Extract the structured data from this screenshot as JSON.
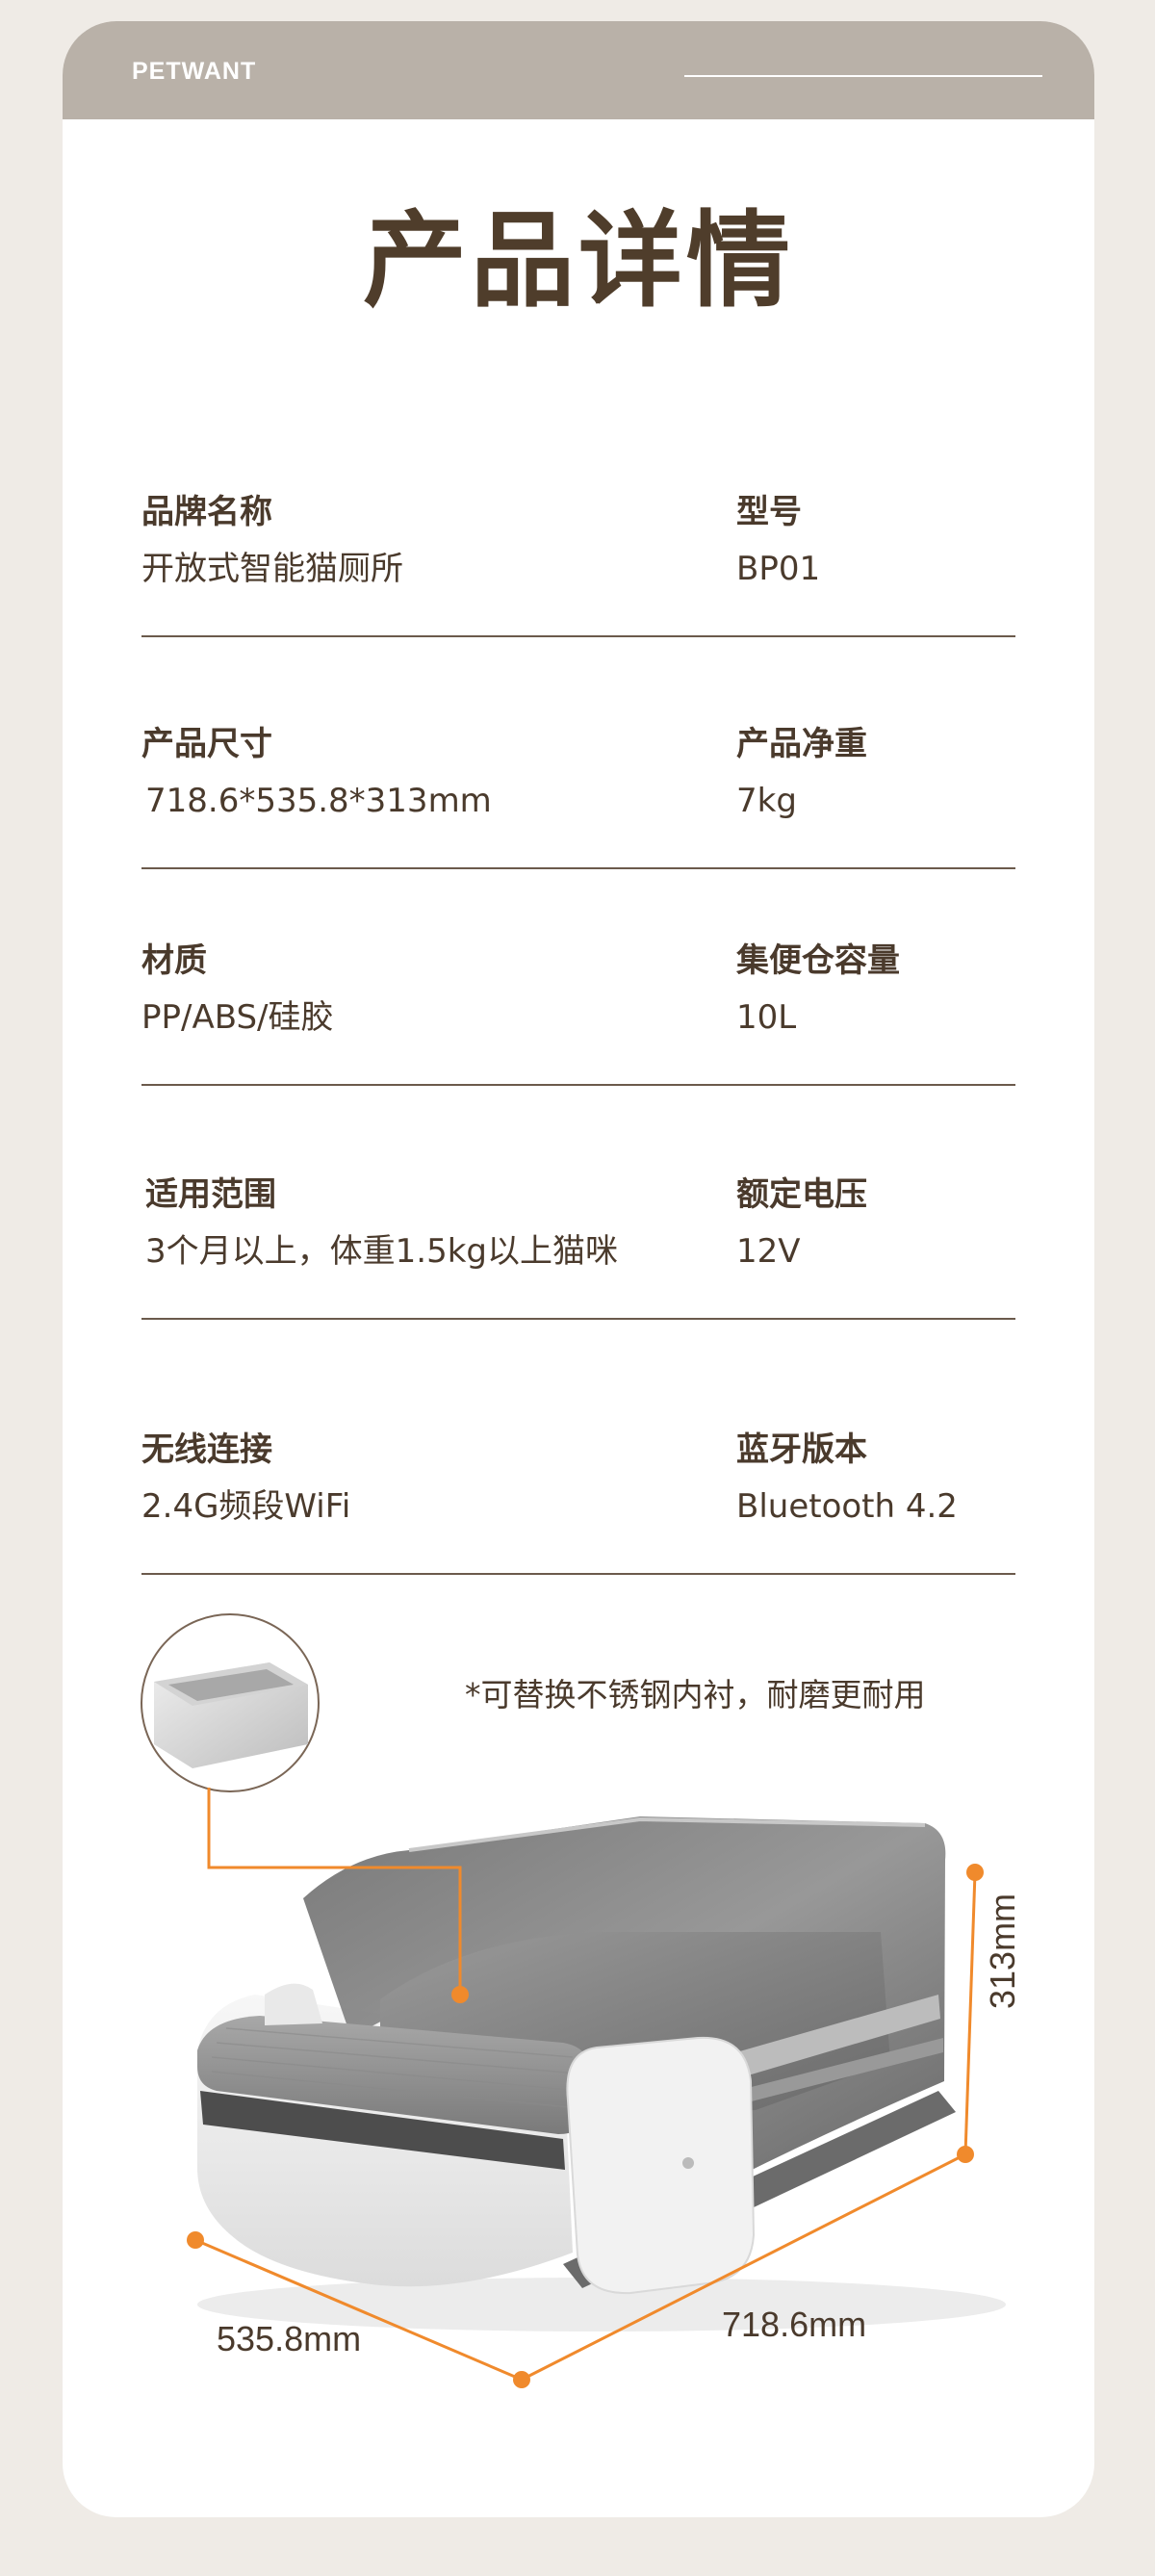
{
  "header": {
    "brand": "PETWANT"
  },
  "title": "产品详情",
  "specs": [
    {
      "left_label": "品牌名称",
      "left_value": "开放式智能猫厕所",
      "right_label": "型号",
      "right_value": "BP01"
    },
    {
      "left_label": "产品尺寸",
      "left_value": "718.6*535.8*313mm",
      "right_label": "产品净重",
      "right_value": "7kg"
    },
    {
      "left_label": "材质",
      "left_value": "PP/ABS/硅胶",
      "right_label": "集便仓容量",
      "right_value": "10L"
    },
    {
      "left_label": "适用范围",
      "left_value": "3个月以上，体重1.5kg以上猫咪",
      "right_label": "额定电压",
      "right_value": "12V"
    },
    {
      "left_label": "无线连接",
      "left_value": "2.4G频段WiFi",
      "right_label": "蓝牙版本",
      "right_value": "Bluetooth 4.2"
    }
  ],
  "product": {
    "note": "*可替换不锈钢内衬，耐磨更耐用",
    "dimensions": {
      "height": "313mm",
      "length": "718.6mm",
      "width": "535.8mm"
    },
    "colors": {
      "accent": "#f08a2c",
      "text": "#4a3a2c",
      "header": "#b9b1a8"
    }
  }
}
